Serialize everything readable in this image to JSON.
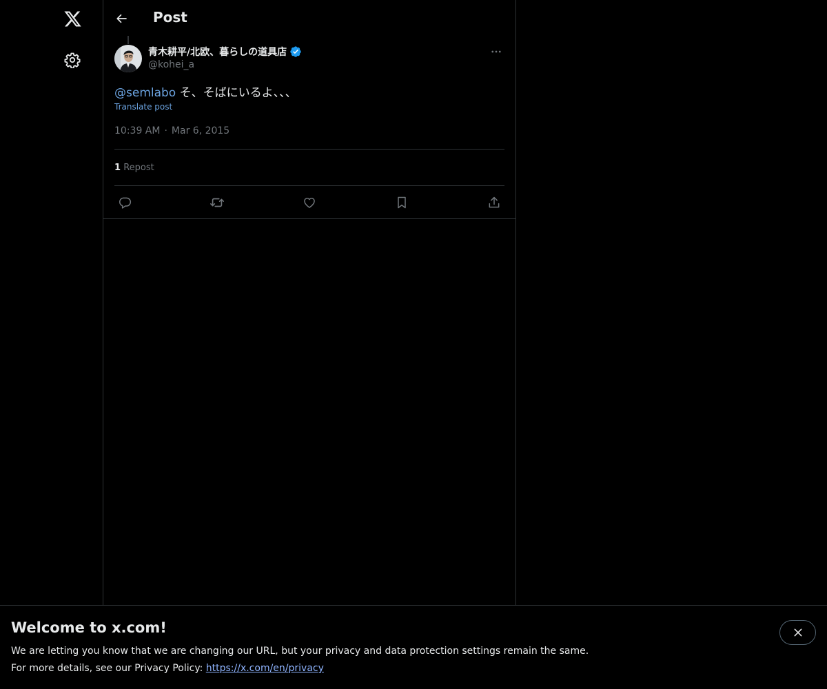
{
  "header": {
    "title": "Post"
  },
  "post": {
    "author": {
      "display_name": "青木耕平/北欧、暮らしの道具店",
      "handle": "@kohei_a",
      "verified": true
    },
    "text": {
      "mention": "@semlabo",
      "rest": " そ、そばにいるよ、、、"
    },
    "translate_label": "Translate post",
    "time": "10:39 AM",
    "separator": "·",
    "date": "Mar 6, 2015",
    "stats": {
      "repost_count": "1",
      "repost_label": "Repost"
    }
  },
  "icons": {
    "nav": [
      "x-logo-icon",
      "settings-gear-icon"
    ],
    "header": "back-arrow-icon",
    "post_menu": "more-dots-icon",
    "actions": [
      "reply-icon",
      "repost-icon",
      "like-icon",
      "bookmark-icon",
      "share-icon"
    ]
  },
  "banner": {
    "title": "Welcome to x.com!",
    "line1": "We are letting you know that we are changing our URL, but your privacy and data protection settings remain the same.",
    "line2_prefix": "For more details, see our Privacy Policy: ",
    "link": "https://x.com/en/privacy"
  },
  "colors": {
    "background": "#000000",
    "text": "#e7e9ea",
    "secondary": "#71767b",
    "link": "#6ba3e0",
    "verified": "#1d9bf0",
    "border": "#2f3336"
  }
}
